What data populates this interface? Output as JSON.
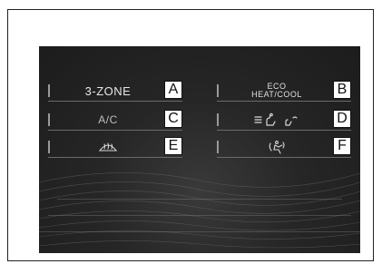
{
  "buttons": [
    {
      "id": "a",
      "label": "3-ZONE",
      "tag": "A"
    },
    {
      "id": "b",
      "label_line1": "ECO",
      "label_line2": "HEAT/COOL",
      "tag": "B"
    },
    {
      "id": "c",
      "label": "A/C",
      "tag": "C"
    },
    {
      "id": "d",
      "icon": "seat-fan-airflow-icon",
      "tag": "D"
    },
    {
      "id": "e",
      "icon": "windshield-defrost-icon",
      "tag": "E"
    },
    {
      "id": "f",
      "icon": "recirculation-icon",
      "tag": "F"
    }
  ],
  "colors": {
    "screen_bg": "#1f1f1f",
    "text": "#e6e6e6",
    "tag_bg": "#ffffff"
  }
}
